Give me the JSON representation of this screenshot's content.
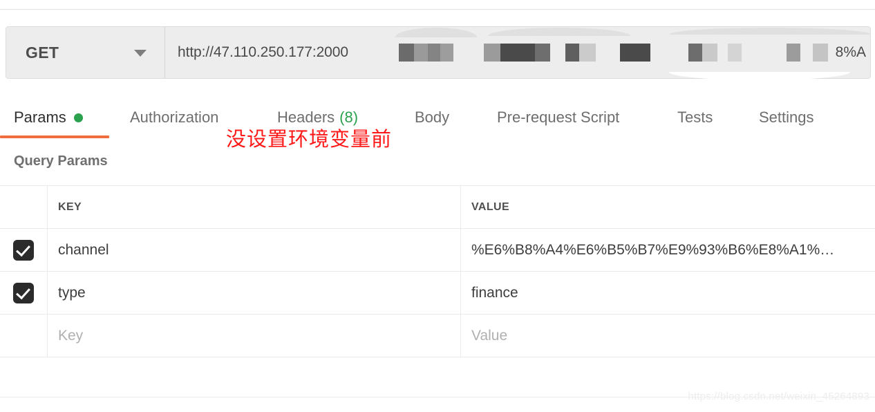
{
  "request_bar": {
    "method": "GET",
    "method_caret_icon": "chevron-down-icon",
    "url_visible": "http://47.110.250.177:2000",
    "url_tail_visible": "8%A",
    "url_redacted": true
  },
  "tabs": [
    {
      "label": "Params",
      "active": true,
      "indicator_dot": true,
      "count": ""
    },
    {
      "label": "Authorization",
      "active": false,
      "indicator_dot": false,
      "count": ""
    },
    {
      "label": "Headers",
      "active": false,
      "indicator_dot": false,
      "count": "(8)"
    },
    {
      "label": "Body",
      "active": false,
      "indicator_dot": false,
      "count": ""
    },
    {
      "label": "Pre-request Script",
      "active": false,
      "indicator_dot": false,
      "count": ""
    },
    {
      "label": "Tests",
      "active": false,
      "indicator_dot": false,
      "count": ""
    },
    {
      "label": "Settings",
      "active": false,
      "indicator_dot": false,
      "count": ""
    }
  ],
  "annotation": {
    "text": "没设置环境变量前"
  },
  "query_params": {
    "title": "Query Params",
    "columns": {
      "key": "KEY",
      "value": "VALUE"
    },
    "rows": [
      {
        "checked": true,
        "key": "channel",
        "value": "%E6%B8%A4%E6%B5%B7%E9%93%B6%E8%A1%…",
        "placeholder": false
      },
      {
        "checked": true,
        "key": "type",
        "value": "finance",
        "placeholder": false
      },
      {
        "checked": false,
        "key": "Key",
        "value": "Value",
        "placeholder": true
      }
    ]
  },
  "watermark": {
    "text": "https://blog.csdn.net/weixin_45264893"
  },
  "colors": {
    "accent_underline": "#ef6c3e",
    "status_dot_green": "#2aa14c",
    "count_green": "#2aa14c",
    "annotation_red": "#ff1a1a",
    "checkbox_dark": "#2b2b2b",
    "bar_background": "#ededed"
  }
}
